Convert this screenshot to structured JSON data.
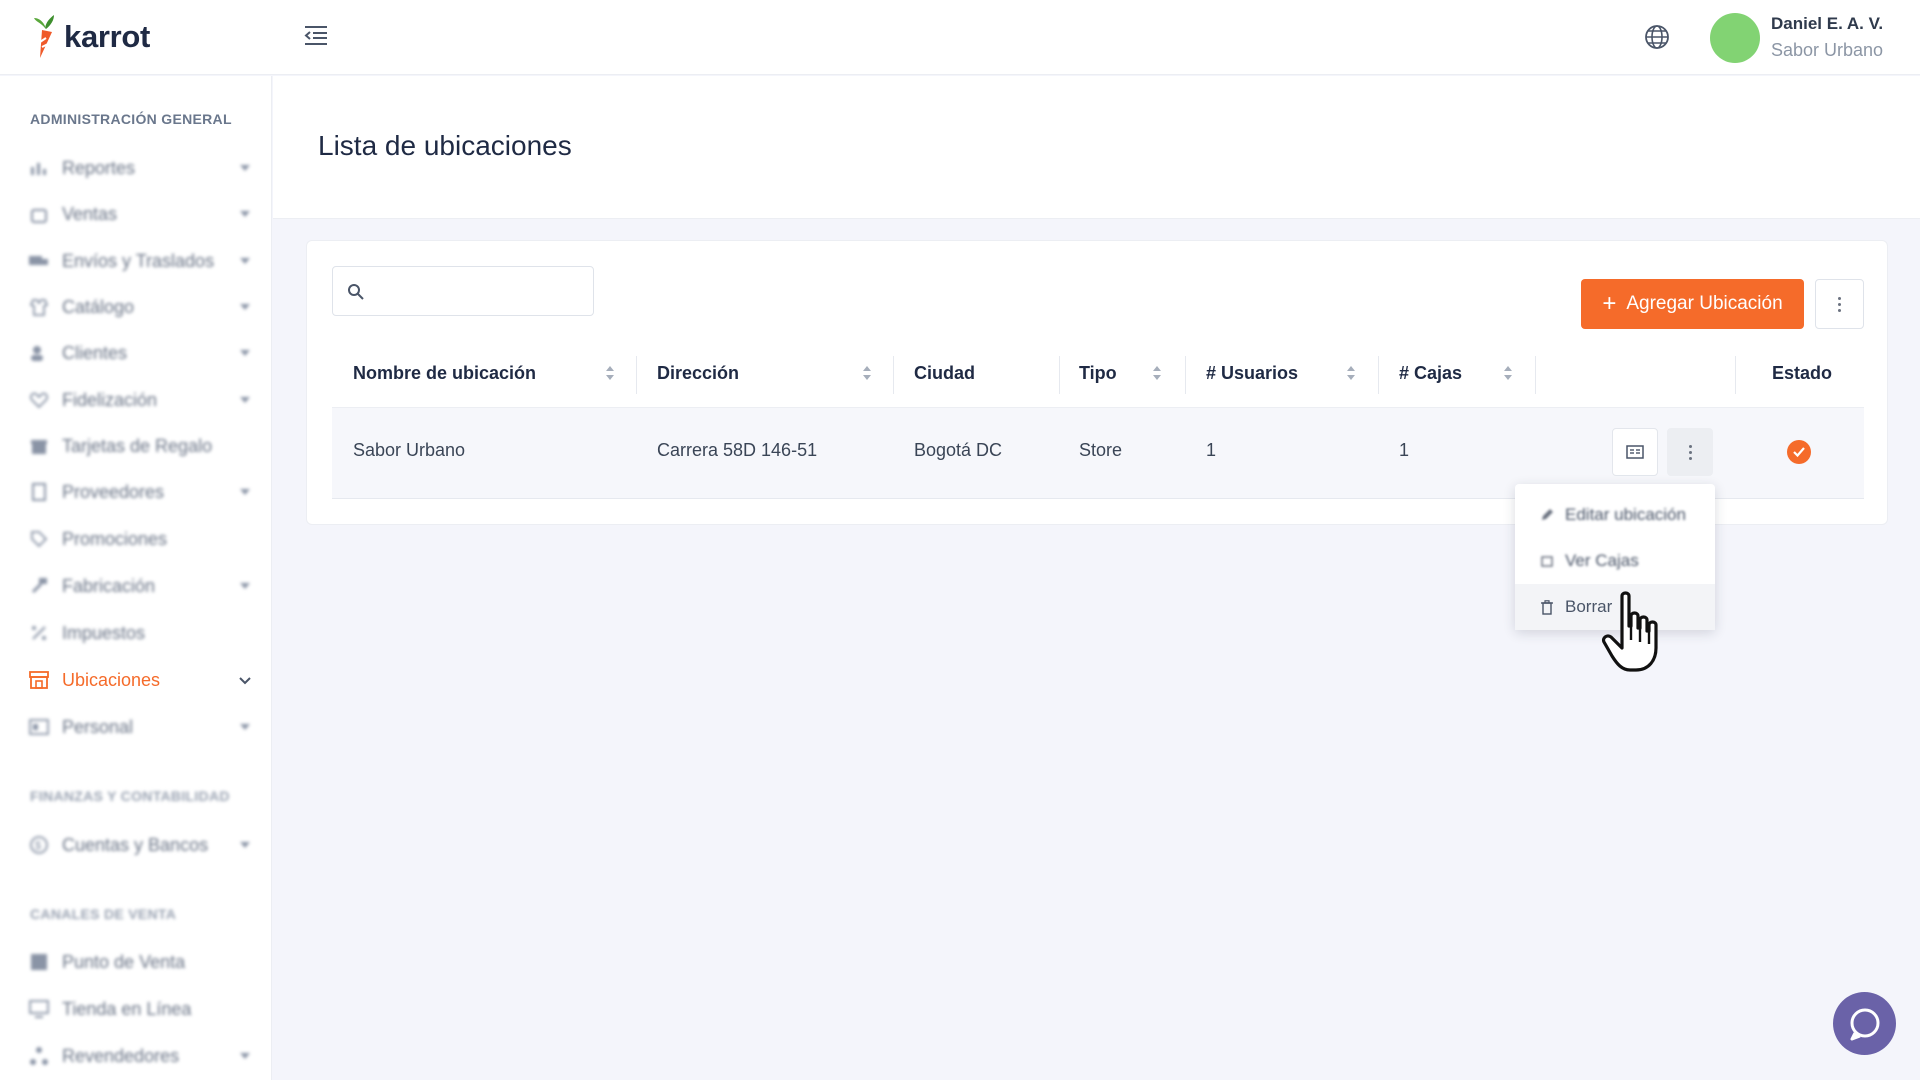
{
  "brand": {
    "name": "karrot"
  },
  "header": {
    "user_name": "Daniel E. A. V.",
    "user_company": "Sabor Urbano",
    "language_icon": "globe-icon",
    "avatar_color": "#82d373"
  },
  "sidebar": {
    "sections": [
      {
        "title": "ADMINISTRACIÓN GENERAL"
      },
      {
        "title": "FINANZAS Y CONTABILIDAD"
      },
      {
        "title": "CANALES DE VENTA"
      }
    ],
    "items": [
      {
        "label": "Reportes",
        "icon": "chart-icon"
      },
      {
        "label": "Ventas",
        "icon": "bag-icon"
      },
      {
        "label": "Envíos y Traslados",
        "icon": "truck-icon"
      },
      {
        "label": "Catálogo",
        "icon": "shirt-icon"
      },
      {
        "label": "Clientes",
        "icon": "users-icon"
      },
      {
        "label": "Fidelización",
        "icon": "heart-icon"
      },
      {
        "label": "Tarjetas de Regalo",
        "icon": "gift-icon"
      },
      {
        "label": "Proveedores",
        "icon": "building-icon"
      },
      {
        "label": "Promociones",
        "icon": "tag-icon"
      },
      {
        "label": "Fabricación",
        "icon": "hammer-icon"
      },
      {
        "label": "Impuestos",
        "icon": "percent-icon"
      },
      {
        "label": "Ubicaciones",
        "icon": "store-icon"
      },
      {
        "label": "Personal",
        "icon": "id-card-icon"
      },
      {
        "label": "Cuentas y Bancos",
        "icon": "dollar-icon"
      },
      {
        "label": "Punto de Venta",
        "icon": "grid-icon"
      },
      {
        "label": "Tienda en Línea",
        "icon": "monitor-icon"
      },
      {
        "label": "Revendedores",
        "icon": "network-icon"
      }
    ]
  },
  "page": {
    "title": "Lista de ubicaciones",
    "search_placeholder": "",
    "add_button_label": "Agregar Ubicación"
  },
  "table": {
    "headers": [
      "Nombre de ubicación",
      "Dirección",
      "Ciudad",
      "Tipo",
      "# Usuarios",
      "# Cajas",
      "Estado"
    ],
    "rows": [
      {
        "name": "Sabor Urbano",
        "address": "Carrera 58D 146-51",
        "city": "Bogotá DC",
        "type": "Store",
        "users": "1",
        "registers": "1",
        "status": "active"
      }
    ]
  },
  "row_menu": {
    "items": [
      {
        "label": "Editar ubicación",
        "icon": "pencil-icon"
      },
      {
        "label": "Ver Cajas",
        "icon": "register-icon"
      },
      {
        "label": "Borrar",
        "icon": "trash-icon"
      }
    ]
  },
  "colors": {
    "accent": "#f56b2a",
    "chat": "#6a62a8"
  }
}
